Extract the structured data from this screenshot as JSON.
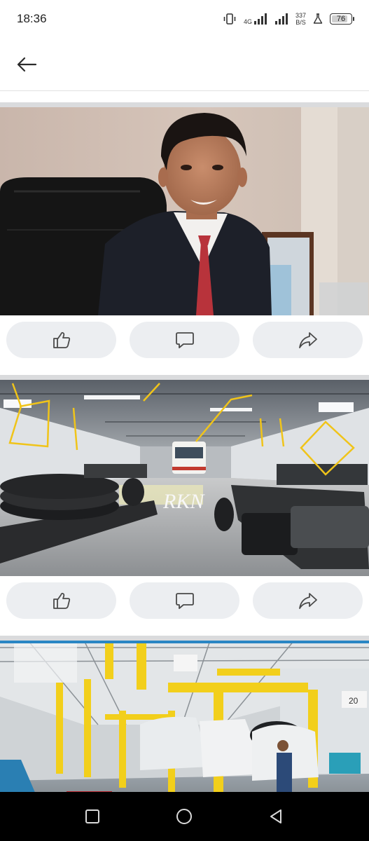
{
  "status_bar": {
    "time": "18:36",
    "network_type": "4G",
    "data_speed_value": "337",
    "data_speed_unit": "B/S",
    "battery_level": "76"
  },
  "app_bar": {
    "back_icon": "arrow-left-icon"
  },
  "posts": [
    {
      "image_subject": "businessman-in-office-photo",
      "actions": [
        {
          "name": "like",
          "icon": "thumbs-up-icon"
        },
        {
          "name": "comment",
          "icon": "speech-bubble-icon"
        },
        {
          "name": "share",
          "icon": "share-arrow-icon"
        }
      ]
    },
    {
      "image_subject": "bus-chassis-factory-photo",
      "watermark": "RKN",
      "actions": [
        {
          "name": "like",
          "icon": "thumbs-up-icon"
        },
        {
          "name": "comment",
          "icon": "speech-bubble-icon"
        },
        {
          "name": "share",
          "icon": "share-arrow-icon"
        }
      ]
    },
    {
      "image_subject": "vehicle-assembly-line-photo",
      "signs": [
        "20"
      ]
    }
  ],
  "nav_bar": {
    "icons": [
      "recents-square-icon",
      "home-circle-icon",
      "back-triangle-icon"
    ]
  },
  "colors": {
    "divider": "#dadbdd",
    "action_button_bg": "#eceef1",
    "icon_gray": "#4a4a4a",
    "nav_bar": "#000000"
  }
}
